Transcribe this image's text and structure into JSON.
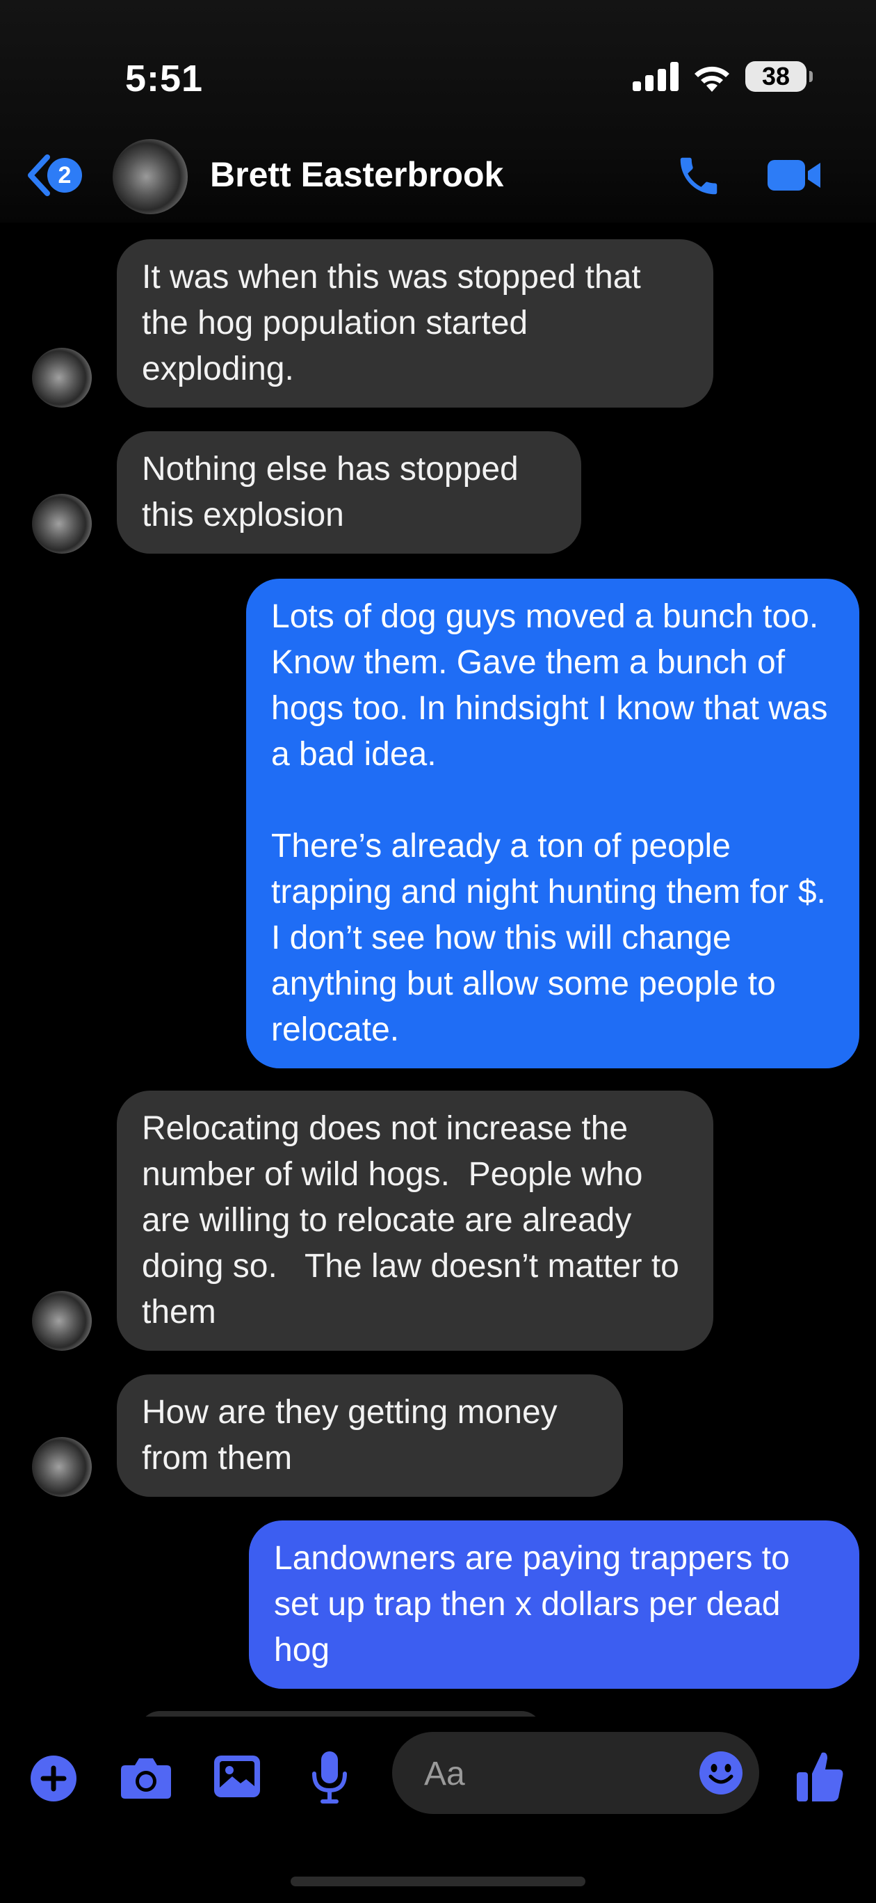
{
  "status_bar": {
    "time": "5:51",
    "battery": "38"
  },
  "header": {
    "back_badge": "2",
    "contact_name": "Brett Easterbrook"
  },
  "messages": [
    {
      "direction": "incoming",
      "text": "It was when this was stopped that the hog population started exploding."
    },
    {
      "direction": "incoming",
      "text": "Nothing else has stopped this explosion"
    },
    {
      "direction": "outgoing",
      "text": "Lots of dog guys moved a bunch too. Know them. Gave them a bunch of hogs too. In hindsight I know that was a bad idea.\n\nThere’s already a ton of people trapping and night hunting them for $. I don’t see how this will change anything but allow some people to relocate."
    },
    {
      "direction": "incoming",
      "text": "Relocating does not increase the number of wild hogs.  People who are willing to relocate are already doing so.   The law doesn’t matter to them"
    },
    {
      "direction": "incoming",
      "text": "How are they getting money from them"
    },
    {
      "direction": "outgoing",
      "text": "Landowners are paying trappers to set up trap then x dollars per dead hog"
    }
  ],
  "composer": {
    "placeholder": "Aa"
  },
  "colors": {
    "accent": "#2d7cf6",
    "outgoing_bubble_top": "#1f6af5",
    "outgoing_bubble_bottom": "#3d5cf0",
    "incoming_bubble": "#333333",
    "composer_icons": "#5167f4"
  }
}
